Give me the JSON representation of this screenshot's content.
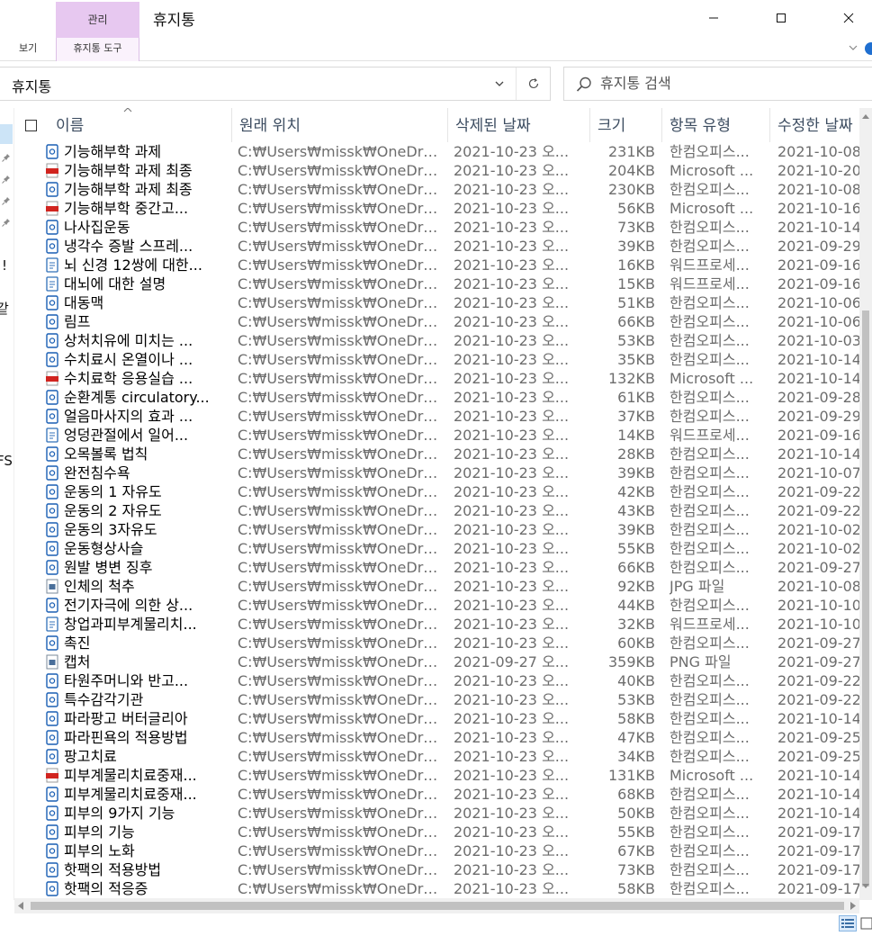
{
  "window": {
    "title": "휴지통",
    "context_tab": "관리",
    "context_color": "#e7c8f0",
    "controls": {
      "minimize": "minimize-icon",
      "maximize": "maximize-icon",
      "close": "close-icon"
    }
  },
  "ribbon": {
    "tabs": [
      "보기",
      "휴지통 도구"
    ]
  },
  "address": {
    "path": "휴지통"
  },
  "search": {
    "placeholder": "휴지통 검색"
  },
  "nav_fragments": [
    "!!",
    "같",
    "FS"
  ],
  "columns": {
    "name": "이름",
    "location": "원래 위치",
    "deleted": "삭제된 날짜",
    "size": "크기",
    "type": "항목 유형",
    "modified": "수정한 날짜"
  },
  "files": [
    {
      "name": "기능해부학 과제",
      "location": "C:₩Users₩missk₩OneDri...",
      "deleted": "2021-10-23 오...",
      "size": "231KB",
      "type": "한컴오피스...",
      "modified": "2021-10-08",
      "icon": "hwp-icon"
    },
    {
      "name": "기능해부학 과제 최종",
      "location": "C:₩Users₩missk₩OneDri...",
      "deleted": "2021-10-23 오...",
      "size": "204KB",
      "type": "Microsoft ...",
      "modified": "2021-10-20",
      "icon": "pdf-icon"
    },
    {
      "name": "기능해부학 과제 최종",
      "location": "C:₩Users₩missk₩OneDri...",
      "deleted": "2021-10-23 오...",
      "size": "230KB",
      "type": "한컴오피스...",
      "modified": "2021-10-08",
      "icon": "hwp-icon"
    },
    {
      "name": "기능해부학 중간고...",
      "location": "C:₩Users₩missk₩OneDri...",
      "deleted": "2021-10-23 오...",
      "size": "56KB",
      "type": "Microsoft ...",
      "modified": "2021-10-16",
      "icon": "pdf-icon"
    },
    {
      "name": "나사집운동",
      "location": "C:₩Users₩missk₩OneDri...",
      "deleted": "2021-10-23 오...",
      "size": "73KB",
      "type": "한컴오피스...",
      "modified": "2021-10-14",
      "icon": "hwp-icon"
    },
    {
      "name": "냉각수 증발 스프레...",
      "location": "C:₩Users₩missk₩OneDri...",
      "deleted": "2021-10-23 오...",
      "size": "39KB",
      "type": "한컴오피스...",
      "modified": "2021-09-29",
      "icon": "hwp-icon"
    },
    {
      "name": "뇌 신경 12쌍에 대한...",
      "location": "C:₩Users₩missk₩OneDri...",
      "deleted": "2021-10-23 오...",
      "size": "16KB",
      "type": "워드프로세...",
      "modified": "2021-09-16",
      "icon": "doc-icon"
    },
    {
      "name": "대뇌에 대한 설명",
      "location": "C:₩Users₩missk₩OneDri...",
      "deleted": "2021-10-23 오...",
      "size": "15KB",
      "type": "워드프로세...",
      "modified": "2021-09-16",
      "icon": "doc-icon"
    },
    {
      "name": "대동맥",
      "location": "C:₩Users₩missk₩OneDri...",
      "deleted": "2021-10-23 오...",
      "size": "51KB",
      "type": "한컴오피스...",
      "modified": "2021-10-06",
      "icon": "hwp-icon"
    },
    {
      "name": "림프",
      "location": "C:₩Users₩missk₩OneDri...",
      "deleted": "2021-10-23 오...",
      "size": "66KB",
      "type": "한컴오피스...",
      "modified": "2021-10-06",
      "icon": "hwp-icon"
    },
    {
      "name": "상처치유에 미치는 ...",
      "location": "C:₩Users₩missk₩OneDri...",
      "deleted": "2021-10-23 오...",
      "size": "53KB",
      "type": "한컴오피스...",
      "modified": "2021-10-03",
      "icon": "hwp-icon"
    },
    {
      "name": "수치료시 온열이나 ...",
      "location": "C:₩Users₩missk₩OneDri...",
      "deleted": "2021-10-23 오...",
      "size": "35KB",
      "type": "한컴오피스...",
      "modified": "2021-10-14",
      "icon": "hwp-icon"
    },
    {
      "name": "수치료학 응용실습 ...",
      "location": "C:₩Users₩missk₩OneDri...",
      "deleted": "2021-10-23 오...",
      "size": "132KB",
      "type": "Microsoft ...",
      "modified": "2021-10-14",
      "icon": "pdf-icon"
    },
    {
      "name": "순환계통 circulatory...",
      "location": "C:₩Users₩missk₩OneDri...",
      "deleted": "2021-10-23 오...",
      "size": "61KB",
      "type": "한컴오피스...",
      "modified": "2021-09-28",
      "icon": "hwp-icon"
    },
    {
      "name": "얼음마사지의 효과 ...",
      "location": "C:₩Users₩missk₩OneDri...",
      "deleted": "2021-10-23 오...",
      "size": "37KB",
      "type": "한컴오피스...",
      "modified": "2021-09-29",
      "icon": "hwp-icon"
    },
    {
      "name": "엉덩관절에서 일어...",
      "location": "C:₩Users₩missk₩OneDri...",
      "deleted": "2021-10-23 오...",
      "size": "14KB",
      "type": "워드프로세...",
      "modified": "2021-09-16",
      "icon": "doc-icon"
    },
    {
      "name": "오목볼록 법칙",
      "location": "C:₩Users₩missk₩OneDri...",
      "deleted": "2021-10-23 오...",
      "size": "28KB",
      "type": "한컴오피스...",
      "modified": "2021-10-14",
      "icon": "hwp-icon"
    },
    {
      "name": "완전침수욕",
      "location": "C:₩Users₩missk₩OneDri...",
      "deleted": "2021-10-23 오...",
      "size": "39KB",
      "type": "한컴오피스...",
      "modified": "2021-10-07",
      "icon": "hwp-icon"
    },
    {
      "name": "운동의 1 자유도",
      "location": "C:₩Users₩missk₩OneDri...",
      "deleted": "2021-10-23 오...",
      "size": "42KB",
      "type": "한컴오피스...",
      "modified": "2021-09-22",
      "icon": "hwp-icon"
    },
    {
      "name": "운동의 2 자유도",
      "location": "C:₩Users₩missk₩OneDri...",
      "deleted": "2021-10-23 오...",
      "size": "43KB",
      "type": "한컴오피스...",
      "modified": "2021-09-22",
      "icon": "hwp-icon"
    },
    {
      "name": "운동의 3자유도",
      "location": "C:₩Users₩missk₩OneDri...",
      "deleted": "2021-10-23 오...",
      "size": "39KB",
      "type": "한컴오피스...",
      "modified": "2021-10-02",
      "icon": "hwp-icon"
    },
    {
      "name": "운동형상사슬",
      "location": "C:₩Users₩missk₩OneDri...",
      "deleted": "2021-10-23 오...",
      "size": "55KB",
      "type": "한컴오피스...",
      "modified": "2021-10-02",
      "icon": "hwp-icon"
    },
    {
      "name": "원발 병변 징후",
      "location": "C:₩Users₩missk₩OneDri...",
      "deleted": "2021-10-23 오...",
      "size": "66KB",
      "type": "한컴오피스...",
      "modified": "2021-09-27",
      "icon": "hwp-icon"
    },
    {
      "name": "인체의 척추",
      "location": "C:₩Users₩missk₩OneDri...",
      "deleted": "2021-10-23 오...",
      "size": "92KB",
      "type": "JPG 파일",
      "modified": "2021-10-08",
      "icon": "image-icon"
    },
    {
      "name": "전기자극에 의한 상...",
      "location": "C:₩Users₩missk₩OneDri...",
      "deleted": "2021-10-23 오...",
      "size": "44KB",
      "type": "한컴오피스...",
      "modified": "2021-10-10",
      "icon": "hwp-icon"
    },
    {
      "name": "창업과피부계물리치...",
      "location": "C:₩Users₩missk₩OneDri...",
      "deleted": "2021-10-23 오...",
      "size": "32KB",
      "type": "워드프로세...",
      "modified": "2021-10-10",
      "icon": "doc-icon"
    },
    {
      "name": "촉진",
      "location": "C:₩Users₩missk₩OneDri...",
      "deleted": "2021-10-23 오...",
      "size": "60KB",
      "type": "한컴오피스...",
      "modified": "2021-09-27",
      "icon": "hwp-icon"
    },
    {
      "name": "캡처",
      "location": "C:₩Users₩missk₩OneDri...",
      "deleted": "2021-09-27 오...",
      "size": "359KB",
      "type": "PNG 파일",
      "modified": "2021-09-27",
      "icon": "image-icon"
    },
    {
      "name": "타원주머니와 반고...",
      "location": "C:₩Users₩missk₩OneDri...",
      "deleted": "2021-10-23 오...",
      "size": "40KB",
      "type": "한컴오피스...",
      "modified": "2021-09-22",
      "icon": "hwp-icon"
    },
    {
      "name": "특수감각기관",
      "location": "C:₩Users₩missk₩OneDri...",
      "deleted": "2021-10-23 오...",
      "size": "53KB",
      "type": "한컴오피스...",
      "modified": "2021-09-22",
      "icon": "hwp-icon"
    },
    {
      "name": "파라팡고 버터글리아",
      "location": "C:₩Users₩missk₩OneDri...",
      "deleted": "2021-10-23 오...",
      "size": "58KB",
      "type": "한컴오피스...",
      "modified": "2021-10-14",
      "icon": "hwp-icon"
    },
    {
      "name": "파라핀욕의 적용방법",
      "location": "C:₩Users₩missk₩OneDri...",
      "deleted": "2021-10-23 오...",
      "size": "47KB",
      "type": "한컴오피스...",
      "modified": "2021-09-25",
      "icon": "hwp-icon"
    },
    {
      "name": "팡고치료",
      "location": "C:₩Users₩missk₩OneDri...",
      "deleted": "2021-10-23 오...",
      "size": "34KB",
      "type": "한컴오피스...",
      "modified": "2021-09-25",
      "icon": "hwp-icon"
    },
    {
      "name": "피부계물리치료중재...",
      "location": "C:₩Users₩missk₩OneDri...",
      "deleted": "2021-10-23 오...",
      "size": "131KB",
      "type": "Microsoft ...",
      "modified": "2021-10-14",
      "icon": "pdf-icon"
    },
    {
      "name": "피부계물리치료중재...",
      "location": "C:₩Users₩missk₩OneDri...",
      "deleted": "2021-10-23 오...",
      "size": "68KB",
      "type": "한컴오피스...",
      "modified": "2021-10-14",
      "icon": "hwp-icon"
    },
    {
      "name": "피부의 9가지 기능",
      "location": "C:₩Users₩missk₩OneDri...",
      "deleted": "2021-10-23 오...",
      "size": "50KB",
      "type": "한컴오피스...",
      "modified": "2021-10-14",
      "icon": "hwp-icon"
    },
    {
      "name": "피부의 기능",
      "location": "C:₩Users₩missk₩OneDri...",
      "deleted": "2021-10-23 오...",
      "size": "55KB",
      "type": "한컴오피스...",
      "modified": "2021-09-17",
      "icon": "hwp-icon"
    },
    {
      "name": "피부의 노화",
      "location": "C:₩Users₩missk₩OneDri...",
      "deleted": "2021-10-23 오...",
      "size": "67KB",
      "type": "한컴오피스...",
      "modified": "2021-09-17",
      "icon": "hwp-icon"
    },
    {
      "name": "핫팩의 적용방법",
      "location": "C:₩Users₩missk₩OneDri...",
      "deleted": "2021-10-23 오...",
      "size": "73KB",
      "type": "한컴오피스...",
      "modified": "2021-09-17",
      "icon": "hwp-icon"
    },
    {
      "name": "핫팩의 적응증",
      "location": "C:₩Users₩missk₩OneDri...",
      "deleted": "2021-10-23 오...",
      "size": "58KB",
      "type": "한컴오피스...",
      "modified": "2021-09-17",
      "icon": "hwp-icon"
    }
  ],
  "statusbar": {
    "views": [
      "details-view-icon",
      "large-icons-view-icon"
    ]
  }
}
